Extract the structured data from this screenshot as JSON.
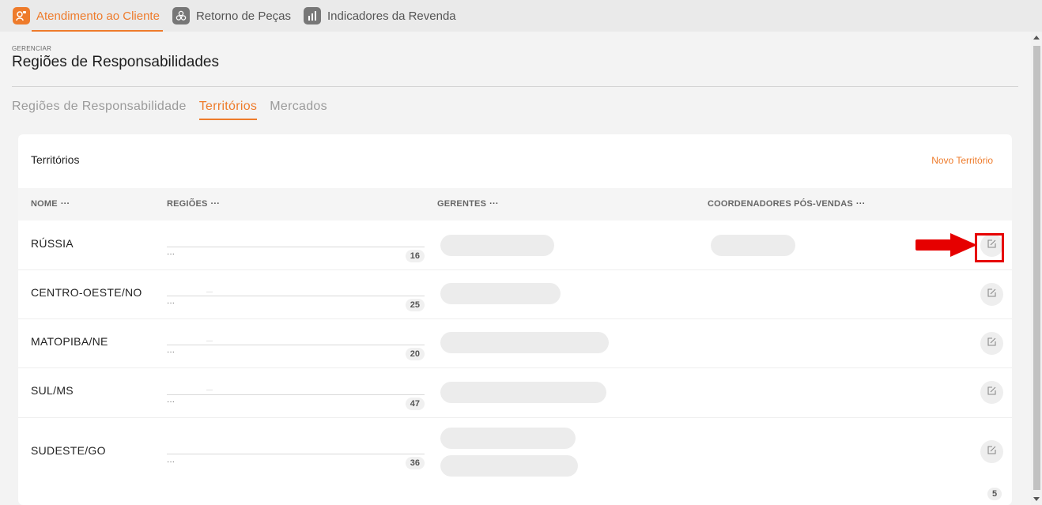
{
  "nav": {
    "items": [
      {
        "label": "Atendimento ao Cliente",
        "icon": "customer-service-icon",
        "active": true
      },
      {
        "label": "Retorno de Peças",
        "icon": "parts-return-icon",
        "active": false
      },
      {
        "label": "Indicadores da Revenda",
        "icon": "bar-chart-icon",
        "active": false
      }
    ]
  },
  "header": {
    "kicker": "GERENCIAR",
    "title": "Regiões de Responsabilidades"
  },
  "tabs": [
    {
      "label": "Regiões de Responsabilidade",
      "active": false
    },
    {
      "label": "Territórios",
      "active": true
    },
    {
      "label": "Mercados",
      "active": false
    }
  ],
  "card": {
    "title": "Territórios",
    "new_button": "Novo Território",
    "columns": {
      "nome": "NOME",
      "regioes": "REGIÕES",
      "gerentes": "GERENTES",
      "coordenadores": "COORDENADORES PÓS-VENDAS",
      "menu": "···"
    },
    "rows": [
      {
        "name": "RÚSSIA",
        "more": "···",
        "count": "16"
      },
      {
        "name": "CENTRO-OESTE/NO",
        "more": "···",
        "count": "25"
      },
      {
        "name": "MATOPIBA/NE",
        "more": "···",
        "count": "20"
      },
      {
        "name": "SUL/MS",
        "more": "···",
        "count": "47"
      },
      {
        "name": "SUDESTE/GO",
        "more": "···",
        "count": "36"
      }
    ],
    "total": "5"
  },
  "icons": {
    "edit": "edit-icon",
    "arrow": "red-arrow-annotation"
  },
  "colors": {
    "accent": "#ee7b2b",
    "annotation": "#e60000"
  }
}
